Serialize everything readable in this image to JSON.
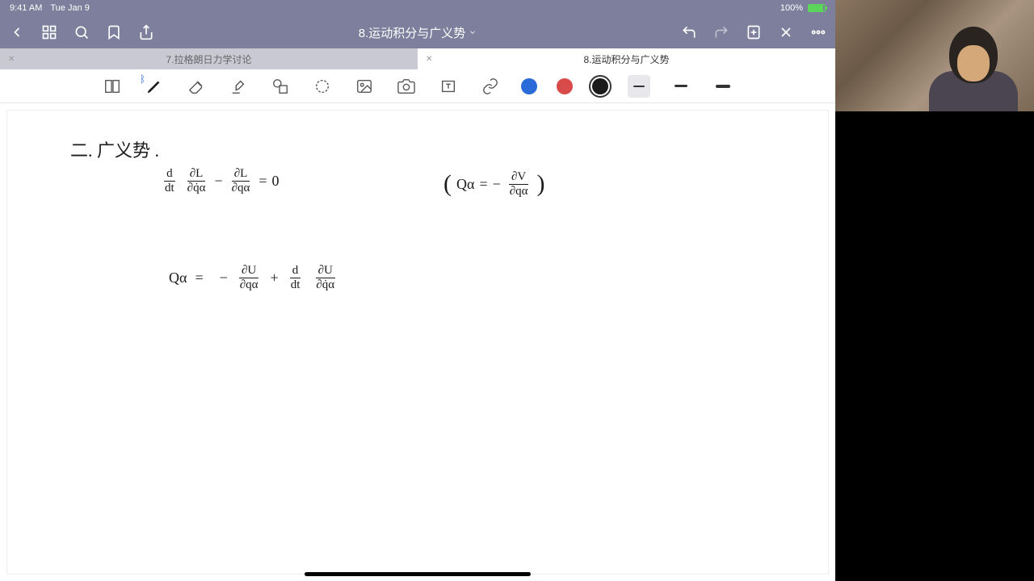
{
  "status": {
    "time": "9:41 AM",
    "date": "Tue Jan 9",
    "battery_percent": "100%"
  },
  "header": {
    "title": "8.运动积分与广义势"
  },
  "tabs": [
    {
      "label": "7.拉格朗日力学讨论",
      "active": false
    },
    {
      "label": "8.运动积分与广义势",
      "active": true
    }
  ],
  "toolbar": {
    "colors": {
      "blue": "#2b6ad9",
      "red": "#d94b4b",
      "black": "#1a1a1a"
    },
    "selected_color": "black",
    "selected_stroke": "thin"
  },
  "handwriting": {
    "section_title": "二. 广义势 .",
    "eq1_lhs_frac1_num": "d",
    "eq1_lhs_frac1_den": "dt",
    "eq1_lhs_frac2_num": "∂L",
    "eq1_lhs_frac2_den": "∂q̇α",
    "eq1_minus": "−",
    "eq1_lhs_frac3_num": "∂L",
    "eq1_lhs_frac3_den": "∂qα",
    "eq1_eq": "=",
    "eq1_rhs": "0",
    "eq2_open": "(",
    "eq2_lhs": "Qα",
    "eq2_eq": "=",
    "eq2_neg": "−",
    "eq2_frac_num": "∂V",
    "eq2_frac_den": "∂qα",
    "eq2_close": ")",
    "eq3_lhs": "Qα",
    "eq3_eq": "=",
    "eq3_neg": "−",
    "eq3_frac1_num": "∂U",
    "eq3_frac1_den": "∂qα",
    "eq3_plus": "+",
    "eq3_frac2_num": "d",
    "eq3_frac2_den": "dt",
    "eq3_frac3_num": "∂U",
    "eq3_frac3_den": "∂q̇α"
  }
}
